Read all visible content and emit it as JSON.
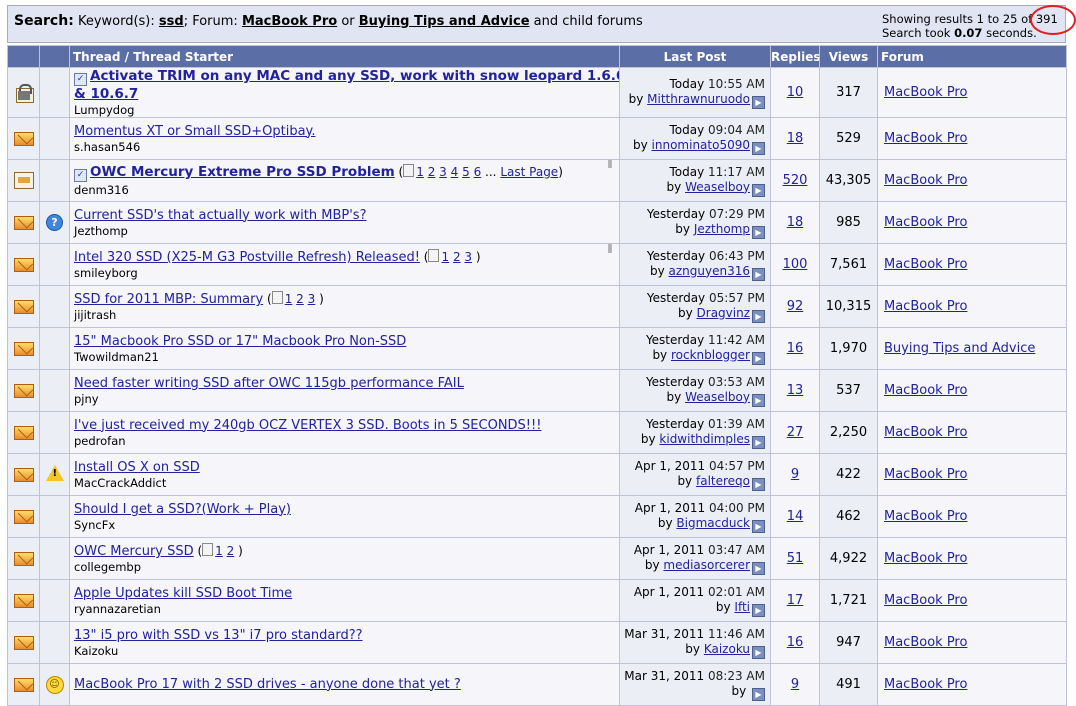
{
  "search": {
    "label": "Search:",
    "keywords_label": "Keyword(s):",
    "keyword": "ssd",
    "forum_label": "; Forum:",
    "forum1": "MacBook Pro",
    "or_text": "or",
    "forum2": "Buying Tips and Advice",
    "child_text": "and child forums",
    "results_prefix": "Showing results 1 to 25 of",
    "results_total": "391",
    "took_prefix": "Search took",
    "took_value": "0.07",
    "took_suffix": "seconds."
  },
  "columns": {
    "thread": "Thread / Thread Starter",
    "last_post": "Last Post",
    "replies": "Replies",
    "views": "Views",
    "forum": "Forum"
  },
  "threads": [
    {
      "title": "Activate TRIM on any MAC and any SSD, work with snow leopard 1.6.6",
      "title2": "& 10.6.7",
      "starter": "Lumpydog",
      "date": "Today",
      "time": "10:55 AM",
      "by": "by",
      "poster": "Mitthrawnuruodo",
      "replies": "10",
      "views": "317",
      "forum": "MacBook Pro"
    },
    {
      "title": "Momentus XT or Small SSD+Optibay.",
      "starter": "s.hasan546",
      "date": "Today",
      "time": "09:04 AM",
      "by": "by",
      "poster": "innominato5090",
      "replies": "18",
      "views": "529",
      "forum": "MacBook Pro"
    },
    {
      "title": "OWC Mercury Extreme Pro SSD Problem",
      "pages": [
        "1",
        "2",
        "3",
        "4",
        "5",
        "6"
      ],
      "ellipsis": "...",
      "last_page": "Last Page",
      "close": ")",
      "starter": "denm316",
      "date": "Today",
      "time": "11:17 AM",
      "by": "by",
      "poster": "Weaselboy",
      "replies": "520",
      "views": "43,305",
      "forum": "MacBook Pro"
    },
    {
      "title": "Current SSD's that actually work with MBP's?",
      "starter": "Jezthomp",
      "date": "Yesterday",
      "time": "07:29 PM",
      "by": "by",
      "poster": "Jezthomp",
      "replies": "18",
      "views": "985",
      "forum": "MacBook Pro"
    },
    {
      "title": "Intel 320 SSD (X25-M G3 Postville Refresh) Released!",
      "pages": [
        "1",
        "2",
        "3"
      ],
      "close": ")",
      "starter": "smileyborg",
      "date": "Yesterday",
      "time": "06:43 PM",
      "by": "by",
      "poster": "aznguyen316",
      "replies": "100",
      "views": "7,561",
      "forum": "MacBook Pro"
    },
    {
      "title": "SSD for 2011 MBP: Summary",
      "pages": [
        "1",
        "2",
        "3"
      ],
      "close": ")",
      "starter": "jijitrash",
      "date": "Yesterday",
      "time": "05:57 PM",
      "by": "by",
      "poster": "Dragvinz",
      "replies": "92",
      "views": "10,315",
      "forum": "MacBook Pro"
    },
    {
      "title": "15\" Macbook Pro SSD or 17\" Macbook Pro Non-SSD",
      "starter": "Twowildman21",
      "date": "Yesterday",
      "time": "11:42 AM",
      "by": "by",
      "poster": "rocknblogger",
      "replies": "16",
      "views": "1,970",
      "forum": "Buying Tips and Advice"
    },
    {
      "title": "Need faster writing SSD after OWC 115gb performance FAIL",
      "starter": "pjny",
      "date": "Yesterday",
      "time": "03:53 AM",
      "by": "by",
      "poster": "Weaselboy",
      "replies": "13",
      "views": "537",
      "forum": "MacBook Pro"
    },
    {
      "title": "I've just received my 240gb OCZ VERTEX 3 SSD. Boots in 5 SECONDS!!!",
      "starter": "pedrofan",
      "date": "Yesterday",
      "time": "01:39 AM",
      "by": "by",
      "poster": "kidwithdimples",
      "replies": "27",
      "views": "2,250",
      "forum": "MacBook Pro"
    },
    {
      "title": "Install OS X on SSD",
      "starter": "MacCrackAddict",
      "date": "Apr 1, 2011",
      "time": "04:57 PM",
      "by": "by",
      "poster": "faltereqo",
      "replies": "9",
      "views": "422",
      "forum": "MacBook Pro"
    },
    {
      "title": "Should I get a SSD?(Work + Play)",
      "starter": "SyncFx",
      "date": "Apr 1, 2011",
      "time": "04:00 PM",
      "by": "by",
      "poster": "Bigmacduck",
      "replies": "14",
      "views": "462",
      "forum": "MacBook Pro"
    },
    {
      "title": "OWC Mercury SSD",
      "pages": [
        "1",
        "2"
      ],
      "close": ")",
      "starter": "collegembp",
      "date": "Apr 1, 2011",
      "time": "03:47 AM",
      "by": "by",
      "poster": "mediasorcerer",
      "replies": "51",
      "views": "4,922",
      "forum": "MacBook Pro"
    },
    {
      "title": "Apple Updates kill SSD Boot Time",
      "starter": "ryannazaretian",
      "date": "Apr 1, 2011",
      "time": "02:01 AM",
      "by": "by",
      "poster": "Ifti",
      "replies": "17",
      "views": "1,721",
      "forum": "MacBook Pro"
    },
    {
      "title": "13\" i5 pro with SSD vs 13\" i7 pro standard??",
      "starter": "Kaizoku",
      "date": "Mar 31, 2011",
      "time": "11:46 AM",
      "by": "by",
      "poster": "Kaizoku",
      "replies": "16",
      "views": "947",
      "forum": "MacBook Pro"
    },
    {
      "title": "MacBook Pro 17 with 2 SSD drives - anyone done that yet ?",
      "starter": "",
      "date": "Mar 31, 2011",
      "time": "08:23 AM",
      "by": "by",
      "poster": "",
      "replies": "9",
      "views": "491",
      "forum": "MacBook Pro"
    }
  ]
}
